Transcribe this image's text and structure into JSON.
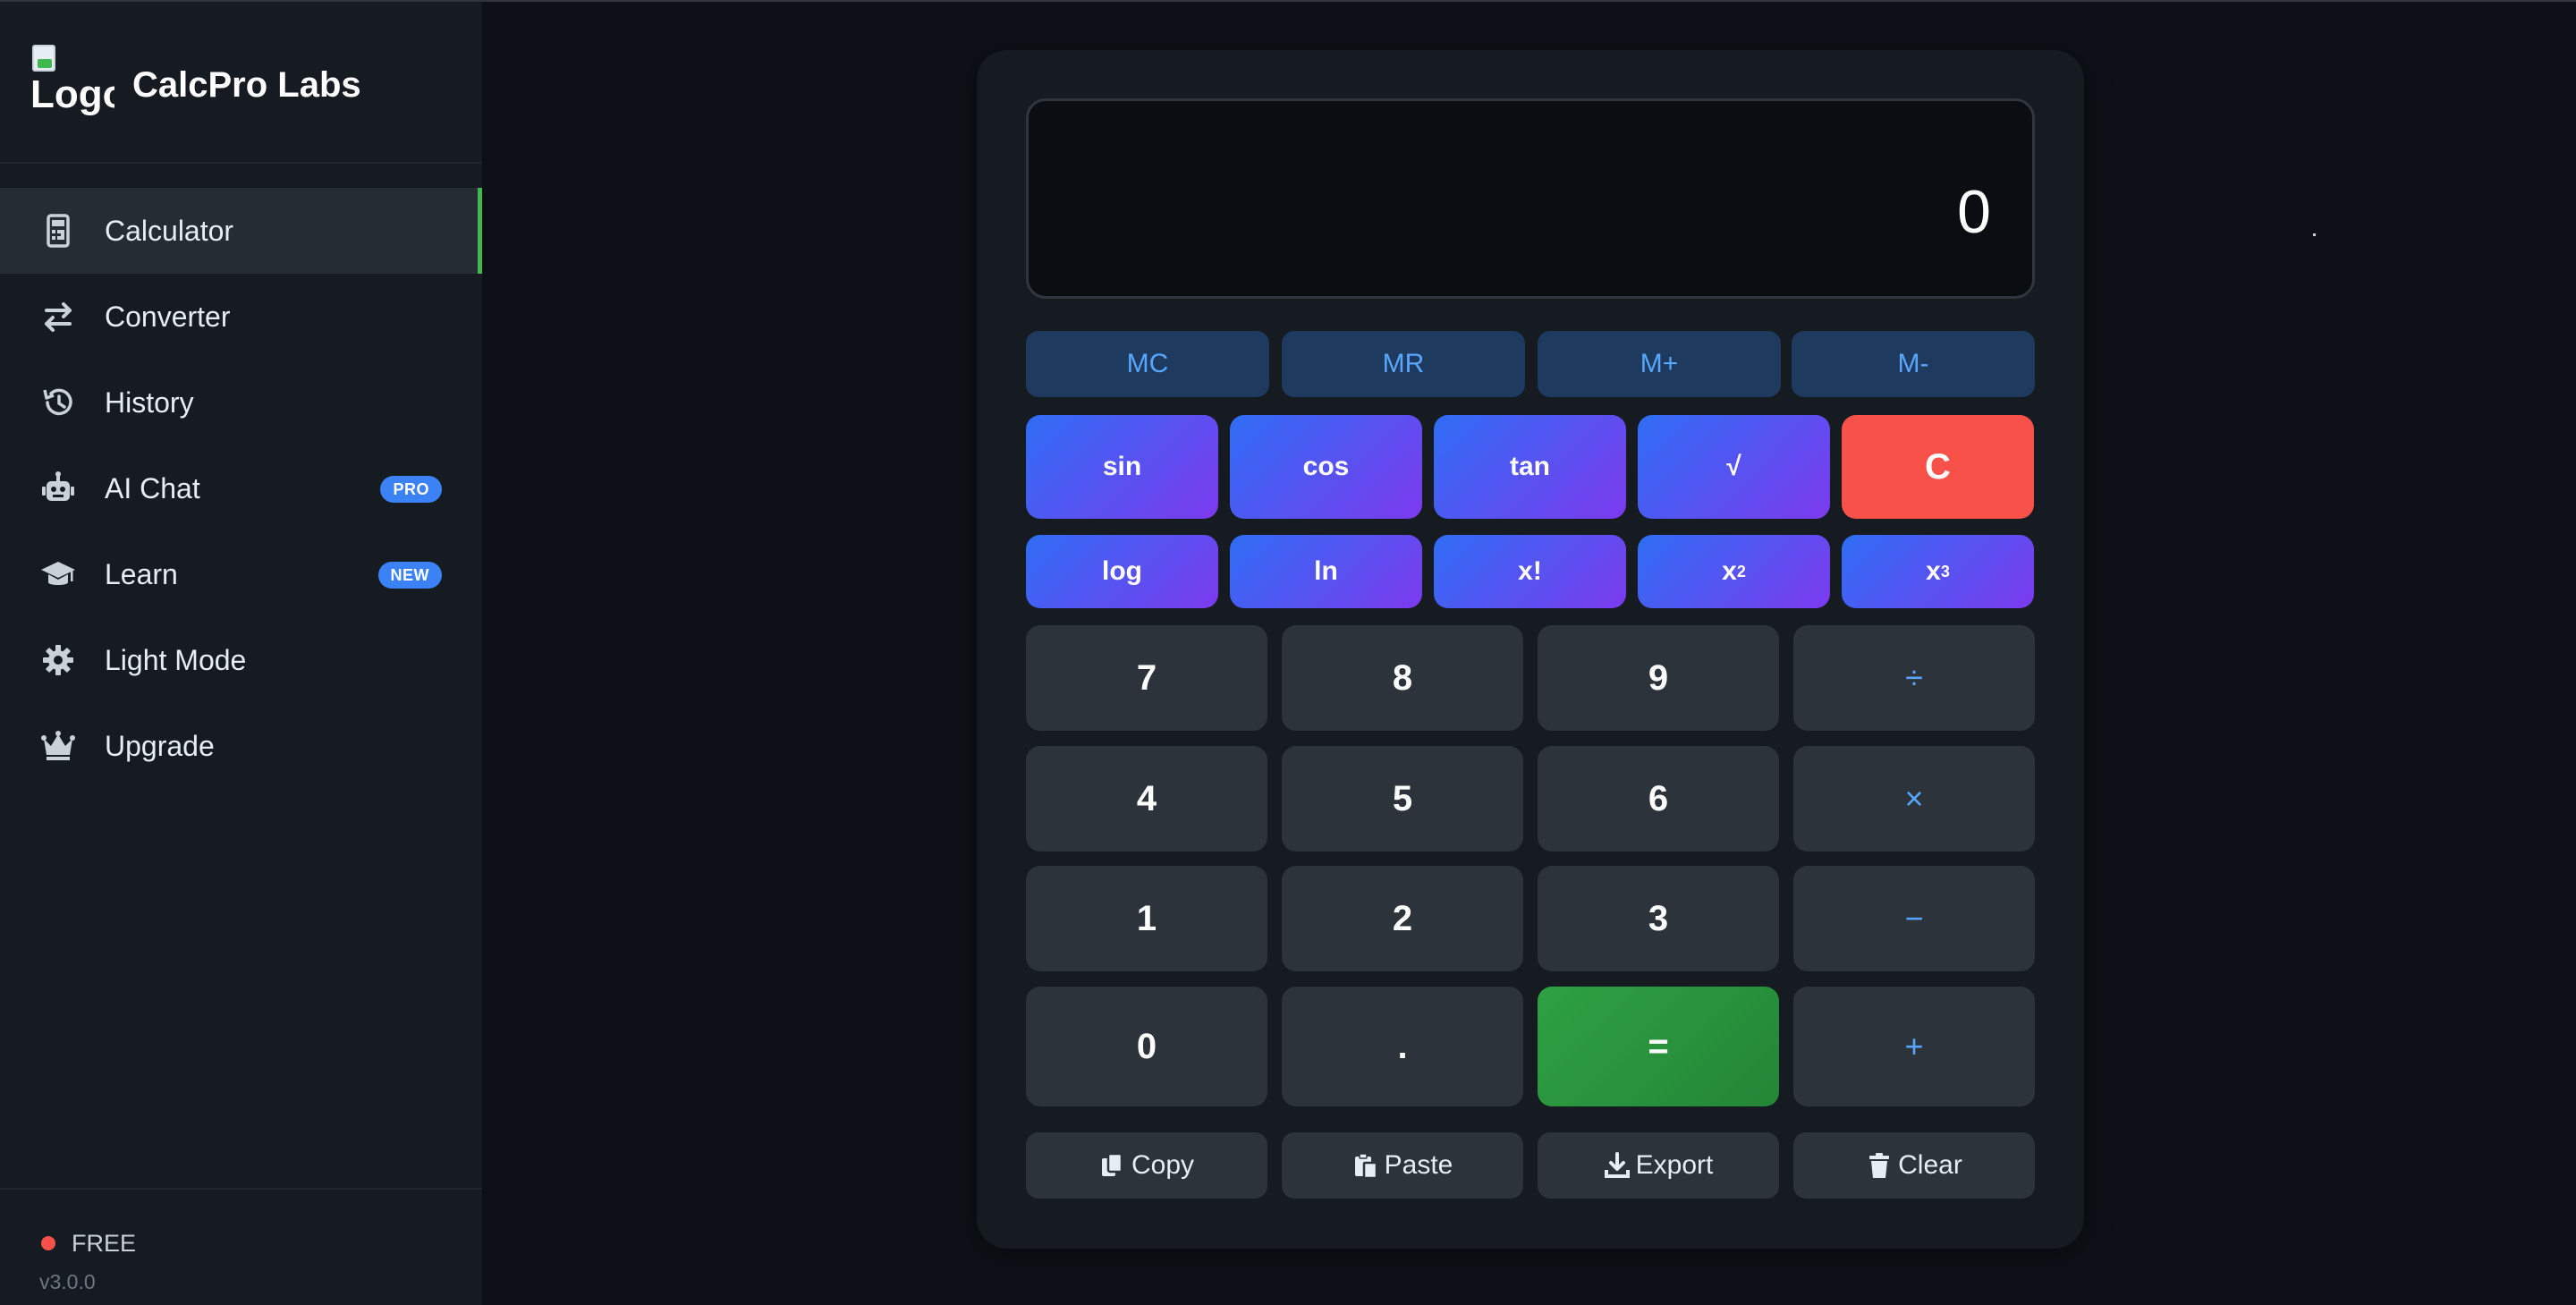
{
  "app": {
    "brand_name": "CalcPro Labs",
    "logo_alt": "Logo"
  },
  "sidebar": {
    "items": [
      {
        "label": "Calculator",
        "icon": "calculator-icon",
        "active": true,
        "badge": ""
      },
      {
        "label": "Converter",
        "icon": "swap-arrows-icon",
        "active": false,
        "badge": ""
      },
      {
        "label": "History",
        "icon": "history-icon",
        "active": false,
        "badge": ""
      },
      {
        "label": "AI Chat",
        "icon": "robot-icon",
        "active": false,
        "badge": "PRO"
      },
      {
        "label": "Learn",
        "icon": "graduation-cap-icon",
        "active": false,
        "badge": "NEW"
      },
      {
        "label": "Light Mode",
        "icon": "gear-icon",
        "active": false,
        "badge": ""
      },
      {
        "label": "Upgrade",
        "icon": "crown-icon",
        "active": false,
        "badge": ""
      }
    ],
    "footer": {
      "plan": "FREE",
      "version": "v3.0.0"
    }
  },
  "calculator": {
    "display": "0",
    "memory": [
      "MC",
      "MR",
      "M+",
      "M-"
    ],
    "scientific_row1": [
      "sin",
      "cos",
      "tan",
      "√",
      "C"
    ],
    "scientific_row2": [
      "log",
      "ln",
      "x!",
      "x",
      "x"
    ],
    "superscripts": [
      "2",
      "3"
    ],
    "keypad": [
      [
        "7",
        "8",
        "9",
        "÷"
      ],
      [
        "4",
        "5",
        "6",
        "×"
      ],
      [
        "1",
        "2",
        "3",
        "−"
      ],
      [
        "0",
        ".",
        "=",
        "+"
      ]
    ],
    "actions": [
      "Copy",
      "Paste",
      "Export",
      "Clear"
    ]
  },
  "colors": {
    "accent_green": "#3fb950",
    "clear_red": "#f85149",
    "operator_blue": "#58a6ff",
    "badge_blue": "#3b82f6",
    "gradient_start": "#2f6df5",
    "gradient_end": "#7c3aed"
  }
}
